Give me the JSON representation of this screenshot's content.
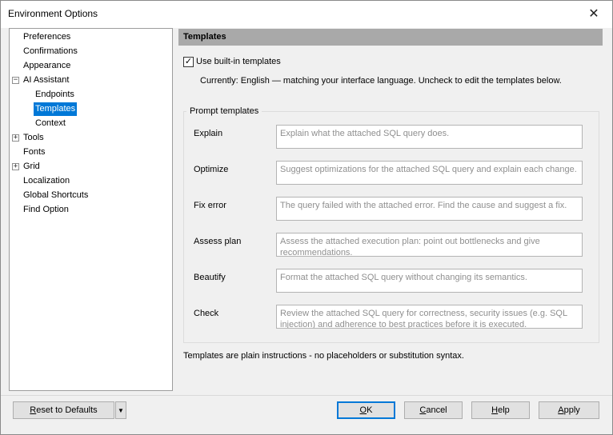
{
  "window": {
    "title": "Environment Options"
  },
  "tree": {
    "items": [
      {
        "label": "Preferences"
      },
      {
        "label": "Confirmations"
      },
      {
        "label": "Appearance"
      },
      {
        "label": "AI Assistant",
        "expander": "-"
      },
      {
        "label": "Endpoints"
      },
      {
        "label": "Templates",
        "selected": true
      },
      {
        "label": "Context"
      },
      {
        "label": "Tools",
        "expander": "+"
      },
      {
        "label": "Fonts"
      },
      {
        "label": "Grid",
        "expander": "+"
      },
      {
        "label": "Localization"
      },
      {
        "label": "Global Shortcuts"
      },
      {
        "label": "Find Option"
      }
    ]
  },
  "panel": {
    "header": "Templates",
    "use_builtin_label": "Use built-in templates",
    "use_builtin_checked": true,
    "currently_text": "Currently: English — matching your interface language. Uncheck to edit the templates below.",
    "group_title": "Prompt templates",
    "templates": [
      {
        "label": "Explain",
        "value": "Explain what the attached SQL query does."
      },
      {
        "label": "Optimize",
        "value": "Suggest optimizations for the attached SQL query and explain each change."
      },
      {
        "label": "Fix error",
        "value": "The query failed with the attached error. Find the cause and suggest a fix."
      },
      {
        "label": "Assess plan",
        "value": "Assess the attached execution plan: point out bottlenecks and give recommendations."
      },
      {
        "label": "Beautify",
        "value": "Format the attached SQL query without changing its semantics."
      },
      {
        "label": "Check",
        "value": "Review the attached SQL query for correctness, security issues (e.g. SQL injection) and adherence to best practices before it is executed."
      }
    ],
    "footnote": "Templates are plain instructions - no placeholders or substitution syntax."
  },
  "buttons": {
    "reset_prefix": "R",
    "reset_rest": "eset to Defaults",
    "ok_prefix": "O",
    "ok_rest": "K",
    "cancel_prefix": "C",
    "cancel_rest": "ancel",
    "help_prefix": "H",
    "help_rest": "elp",
    "apply_prefix": "A",
    "apply_rest": "pply"
  }
}
